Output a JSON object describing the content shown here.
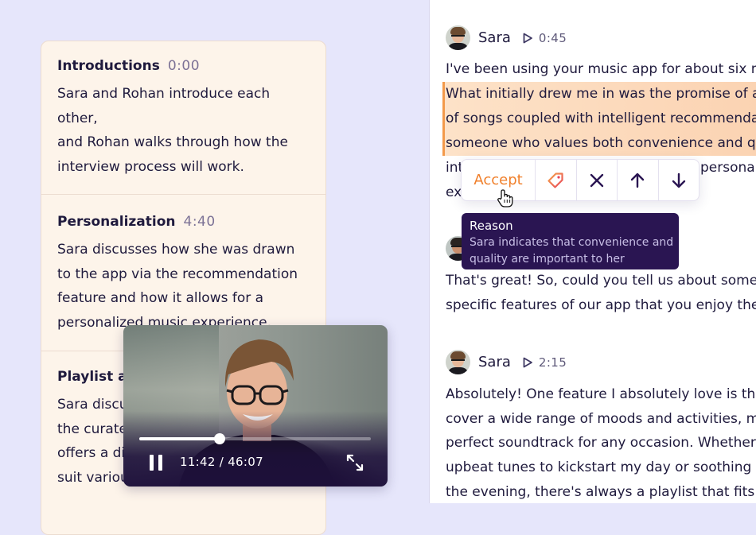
{
  "summary": {
    "sections": [
      {
        "title": "Introductions",
        "time": "0:00",
        "lines": [
          "Sara and Rohan introduce each other,",
          "and Rohan walks through how the",
          "interview process will work."
        ]
      },
      {
        "title": "Personalization",
        "time": "4:40",
        "lines": [
          "Sara discusses how she was drawn",
          "to the app via the recommendation",
          "feature and how it allows for a",
          "personalized music experience."
        ]
      },
      {
        "title": "Playlist ap",
        "time": "",
        "lines": [
          "Sara discu",
          "the curate",
          "offers a di",
          "suit variou"
        ]
      }
    ]
  },
  "video": {
    "time_readout": "11:42 / 46:07",
    "progress": 0.347
  },
  "transcript": {
    "blocks": [
      {
        "speaker": "Sara",
        "time": "0:45",
        "lines": [
          "I've been using your music app for about six m",
          "What initially drew me in was the promise of a",
          "of songs coupled with intelligent recommendat",
          "someone who values both convenience and qu",
          "int",
          "ex"
        ]
      },
      {
        "speaker": "",
        "time": "",
        "lines": [
          "That's great! So, could you tell us about some",
          "specific features of our app that you enjoy the"
        ]
      },
      {
        "speaker": "Sara",
        "time": "2:15",
        "lines": [
          "Absolutely! One feature I absolutely love is the",
          "cover a wide range of moods and activities, ma",
          "perfect soundtrack for any occasion. Whether",
          "upbeat tunes to kickstart my day or soothing m",
          "the evening, there's always a playlist that fits t"
        ]
      }
    ],
    "hidden_fragment": "personali"
  },
  "actionbar": {
    "accept_label": "Accept",
    "icons": [
      "tag-icon",
      "close-icon",
      "arrow-up-icon",
      "arrow-down-icon"
    ]
  },
  "reason": {
    "title": "Reason",
    "text": "Sara indicates that convenience and quality are important to her"
  },
  "colors": {
    "accent": "#f07f2a",
    "highlight": "#fbd8b8",
    "tooltip": "#2a1552",
    "background": "#e6e6fb"
  }
}
